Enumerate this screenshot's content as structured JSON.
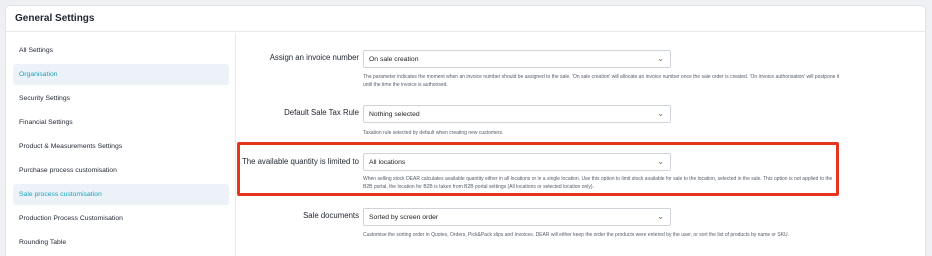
{
  "header": {
    "title": "General Settings"
  },
  "sidebar": {
    "items": [
      {
        "label": "All Settings",
        "active": false
      },
      {
        "label": "Organisation",
        "active": true
      },
      {
        "label": "Security Settings",
        "active": false
      },
      {
        "label": "Financial Settings",
        "active": false
      },
      {
        "label": "Product & Measurements Settings",
        "active": false
      },
      {
        "label": "Purchase process customisation",
        "active": false
      },
      {
        "label": "Sale process customisation",
        "active": true
      },
      {
        "label": "Production Process Customisation",
        "active": false
      },
      {
        "label": "Rounding Table",
        "active": false
      }
    ]
  },
  "settings": {
    "invoice": {
      "label": "Assign an invoice number",
      "value": "On sale creation",
      "hint": "The parameter indicates the moment when an invoice number should be assigned to the sale. 'On sale creation' will allocate an invoice number once the sale order is created. 'On invoice authorisation' will postpone it until the time the invoice is authorised."
    },
    "tax": {
      "label": "Default Sale Tax Rule",
      "value": "Nothing selected",
      "hint": "Taxation rule selected by default when creating new customers."
    },
    "quantity": {
      "label": "The available quantity is limited to",
      "value": "All locations",
      "hint": "When selling stock DEAR calculates available quantity either in all locations or in a single location. Use this option to limit stock available for sale to the location, selected in the sale. This option is not applied to the B2B portal, the location for B2B is taken from B2B portal settings (All locations or selected location only)."
    },
    "documents": {
      "label": "Sale documents",
      "value": "Sorted by screen order",
      "hint": "Customise the sorting order in Quotes, Orders, Pick&Pack slips and Invoices. DEAR will either keep the order the products were entered by the user, or sort the list of products by name or SKU."
    }
  },
  "colors": {
    "accent": "#1aa3b8",
    "highlight": "#e5361d",
    "active_bg": "#edf2f8"
  },
  "icons": {
    "select_arrow": "chevron-down-icon"
  }
}
